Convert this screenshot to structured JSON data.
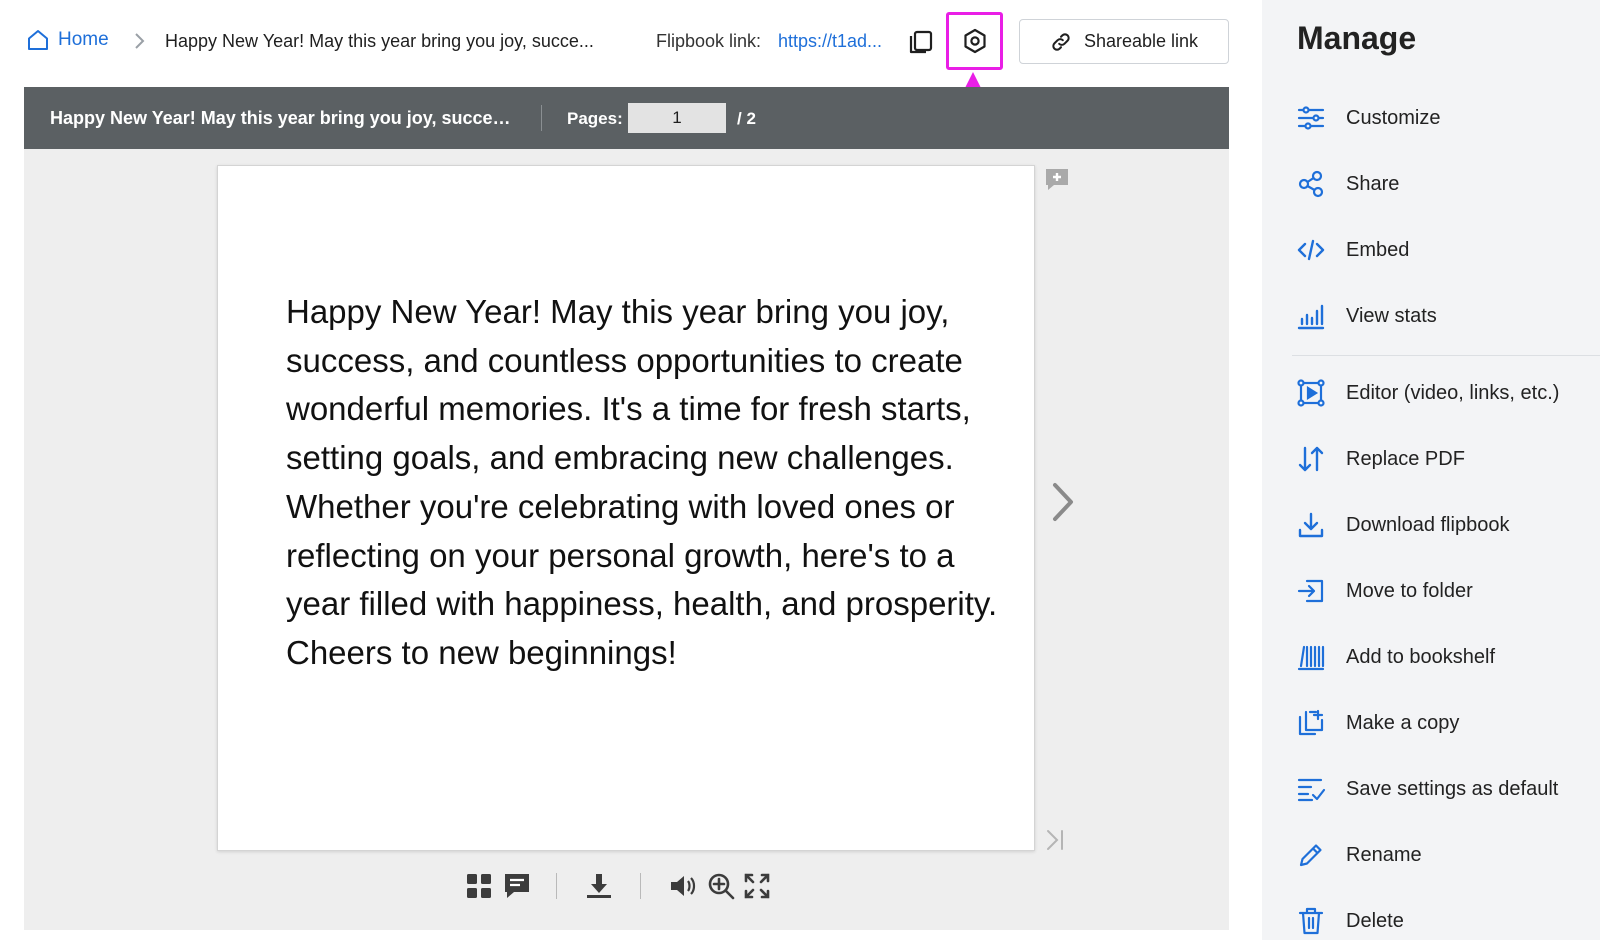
{
  "breadcrumb": {
    "home_label": "Home",
    "current": "Happy New Year! May this year bring you joy, succe..."
  },
  "header": {
    "flipbook_link_label": "Flipbook link:",
    "flipbook_link_url": "https://t1ad...",
    "share_label": "Shareable link"
  },
  "viewer": {
    "title": "Happy New Year! May this year bring you joy, success...",
    "pages_label": "Pages:",
    "current_page": "1",
    "total_pages": "/  2",
    "page_text": "Happy New Year! May this year bring you joy, success, and countless opportunities to create wonderful memories. It's a time for fresh starts, setting goals, and embracing new challenges. Whether you're celebrating with loved ones or reflecting on your personal growth, here's to a year filled with happiness, health, and prosperity. Cheers to new beginnings!"
  },
  "toolbar_icons": [
    "thumbnails-icon",
    "comments-icon",
    "download-icon",
    "sound-icon",
    "zoom-in-icon",
    "fullscreen-icon"
  ],
  "sidebar": {
    "title": "Manage",
    "items": [
      {
        "label": "Customize",
        "icon": "sliders-icon"
      },
      {
        "label": "Share",
        "icon": "share-icon"
      },
      {
        "label": "Embed",
        "icon": "code-icon"
      },
      {
        "label": "View stats",
        "icon": "stats-icon"
      },
      {
        "label": "Editor (video, links, etc.)",
        "icon": "editor-icon"
      },
      {
        "label": "Replace PDF",
        "icon": "swap-icon"
      },
      {
        "label": "Download flipbook",
        "icon": "download-icon"
      },
      {
        "label": "Move to folder",
        "icon": "move-icon"
      },
      {
        "label": "Add to bookshelf",
        "icon": "bookshelf-icon"
      },
      {
        "label": "Make a copy",
        "icon": "copy-icon"
      },
      {
        "label": "Save settings as default",
        "icon": "checklist-icon"
      },
      {
        "label": "Rename",
        "icon": "pencil-icon"
      },
      {
        "label": "Delete",
        "icon": "trash-icon"
      }
    ]
  },
  "colors": {
    "accent": "#1e6fd9",
    "annotation": "#e91ee6",
    "viewer_header": "#5b6063",
    "sidebar_bg": "#f3f4f6"
  }
}
